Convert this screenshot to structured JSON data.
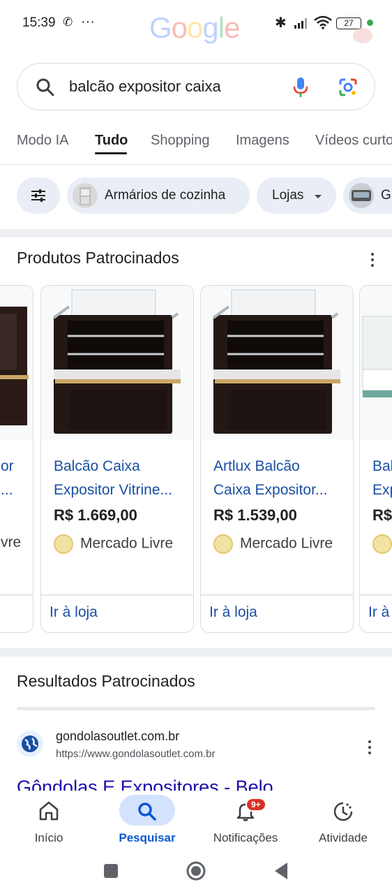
{
  "status_bar": {
    "time": "15:39",
    "battery": "27"
  },
  "search": {
    "query": "balcão expositor caixa"
  },
  "tabs": [
    {
      "label": "Modo IA"
    },
    {
      "label": "Tudo"
    },
    {
      "label": "Shopping"
    },
    {
      "label": "Imagens"
    },
    {
      "label": "Vídeos curtos"
    }
  ],
  "chips": [
    {
      "label": "Armários de cozinha"
    },
    {
      "label": "Lojas"
    },
    {
      "label": "G"
    }
  ],
  "sponsored_products": {
    "title": "Produtos Patrocinados",
    "cards": [
      {
        "title_line1": "Balcão Caixa",
        "title_line2": "Expositor Vitrine...",
        "price": "R$ 1.669,00",
        "store": "Mercado Livre",
        "cta": "Ir à loja"
      },
      {
        "title_line1": "Artlux Balcão",
        "title_line2": "Caixa Expositor...",
        "price": "R$ 1.539,00",
        "store": "Mercado Livre",
        "cta": "Ir à loja"
      }
    ],
    "partial_left": {
      "line1": "or",
      "line2": "...",
      "store": "vre"
    },
    "partial_right": {
      "line1": "Bal",
      "line2": "Exp",
      "price": "R$",
      "cta": "Ir à"
    }
  },
  "sponsored_results": {
    "title": "Resultados Patrocinados",
    "site": "gondolasoutlet.com.br",
    "url": "https://www.gondolasoutlet.com.br",
    "result_title": "Gôndolas E Expositores - Belo"
  },
  "bottom_nav": [
    {
      "label": "Início",
      "icon": "home-icon"
    },
    {
      "label": "Pesquisar",
      "icon": "search-icon"
    },
    {
      "label": "Notificações",
      "icon": "bell-icon",
      "badge": "9+"
    },
    {
      "label": "Atividade",
      "icon": "activity-icon"
    }
  ],
  "colors": {
    "link": "#1a4fa3",
    "accent": "#0b57d0",
    "chip_bg": "#e9eef6"
  }
}
